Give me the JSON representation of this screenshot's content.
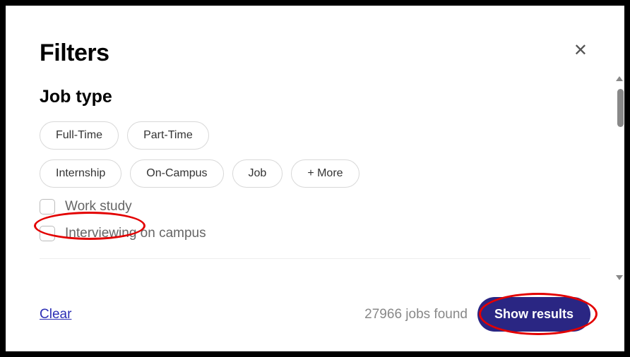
{
  "modal": {
    "title": "Filters",
    "section_title": "Job type"
  },
  "pills": {
    "full_time": "Full-Time",
    "part_time": "Part-Time",
    "internship": "Internship",
    "on_campus": "On-Campus",
    "job": "Job",
    "more": "+ More"
  },
  "checkboxes": {
    "work_study": "Work study",
    "interviewing_on_campus": "Interviewing on campus"
  },
  "footer": {
    "clear": "Clear",
    "results_count": "27966 jobs found",
    "show_results": "Show results"
  }
}
